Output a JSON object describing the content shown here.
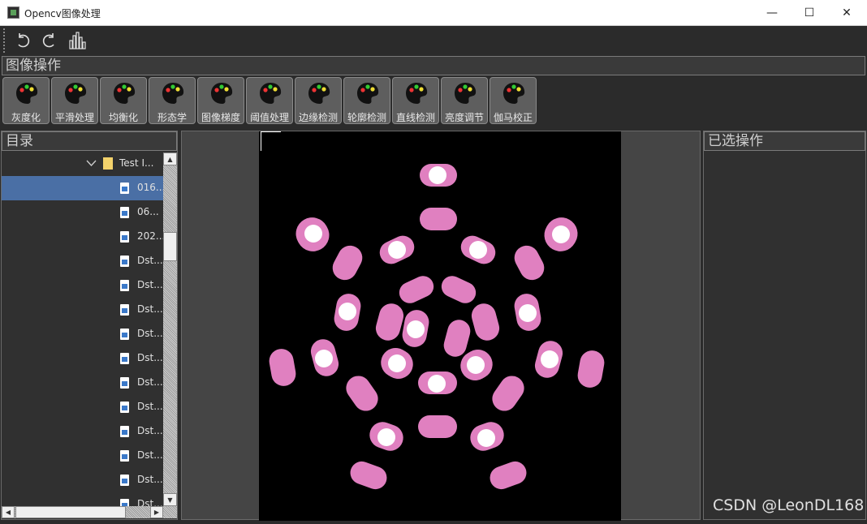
{
  "window": {
    "title": "Opencv图像处理",
    "minimize_glyph": "—",
    "maximize_glyph": "☐",
    "close_glyph": "✕"
  },
  "toolbar": {
    "undo_icon": "undo-icon",
    "redo_icon": "redo-icon",
    "histogram_icon": "histogram-icon"
  },
  "sections": {
    "operations_title": "图像操作",
    "directory_title": "目录",
    "selected_title": "已选操作"
  },
  "operations": [
    {
      "label": "灰度化"
    },
    {
      "label": "平滑处理"
    },
    {
      "label": "均衡化"
    },
    {
      "label": "形态学"
    },
    {
      "label": "图像梯度"
    },
    {
      "label": "阈值处理"
    },
    {
      "label": "边缘检测"
    },
    {
      "label": "轮廓检测"
    },
    {
      "label": "直线检测"
    },
    {
      "label": "亮度调节"
    },
    {
      "label": "伽马校正"
    }
  ],
  "tree": {
    "folder": {
      "label": "Test I...",
      "icon": "folder-icon"
    },
    "files": [
      {
        "label": "016...",
        "selected": true
      },
      {
        "label": "06..."
      },
      {
        "label": "202..."
      },
      {
        "label": "Dst..."
      },
      {
        "label": "Dst..."
      },
      {
        "label": "Dst..."
      },
      {
        "label": "Dst..."
      },
      {
        "label": "Dst..."
      },
      {
        "label": "Dst..."
      },
      {
        "label": "Dst..."
      },
      {
        "label": "Dst..."
      },
      {
        "label": "Dst..."
      },
      {
        "label": "Dst..."
      },
      {
        "label": "Dst..."
      }
    ]
  },
  "colors": {
    "accent_selected": "#4a6fa5",
    "blob_pink": "#e080c0",
    "blob_core": "#ffffff",
    "canvas_bg": "#000000",
    "viewer_bg": "#454545"
  },
  "watermark": "CSDN @LeonDL168"
}
